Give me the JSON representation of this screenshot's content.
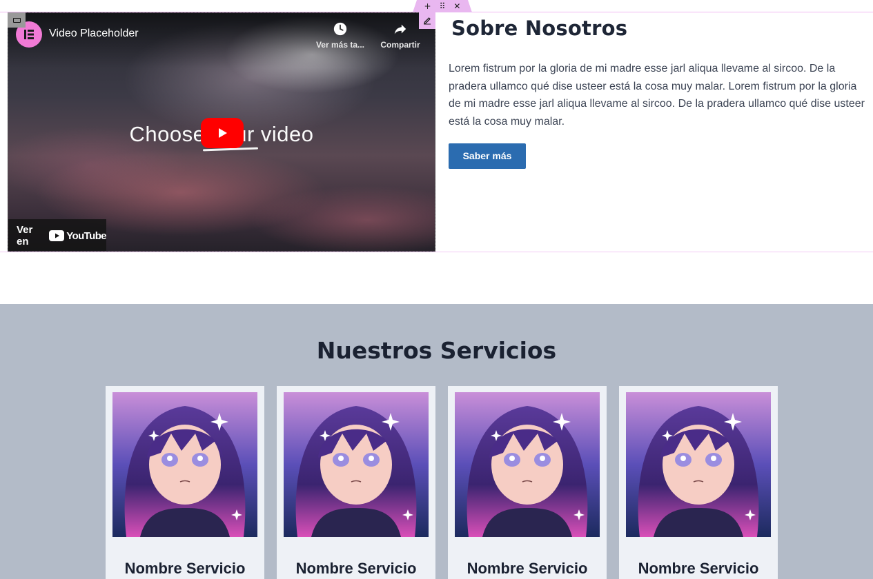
{
  "editor": {
    "add_icon": "plus-icon",
    "drag_icon": "drag-grid-icon",
    "close_icon": "close-icon",
    "edit_icon": "pencil-icon"
  },
  "video": {
    "title": "Video Placeholder",
    "watch_later_label": "Ver más ta...",
    "share_label": "Compartir",
    "center_text": "Choose your video",
    "watch_on_label": "Ver en",
    "youtube_label": "YouTube",
    "colors": {
      "play_button": "#ff0000",
      "logo": "#f27ad6"
    }
  },
  "about": {
    "title": "Sobre Nosotros",
    "body": "Lorem fistrum por la gloria de mi madre esse jarl aliqua llevame al sircoo. De la pradera ullamco qué dise usteer está la cosa muy malar. Lorem fistrum por la gloria de mi madre esse jarl aliqua llevame al sircoo. De la pradera ullamco qué dise usteer está la cosa muy malar.",
    "button_label": "Saber más",
    "button_color": "#2b6cb0"
  },
  "services": {
    "title": "Nuestros Servicios",
    "background": "#b3bbc8",
    "cards": [
      {
        "name": "Nombre Servicio"
      },
      {
        "name": "Nombre Servicio"
      },
      {
        "name": "Nombre Servicio"
      },
      {
        "name": "Nombre Servicio"
      }
    ]
  }
}
